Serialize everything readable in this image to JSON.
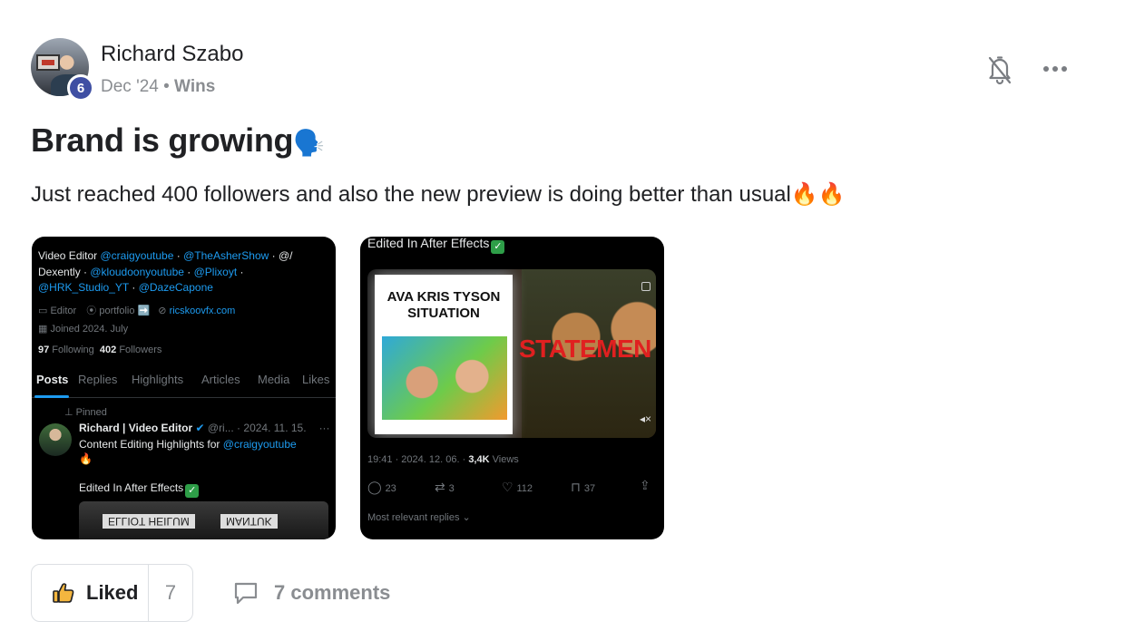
{
  "post": {
    "author": "Richard Szabo",
    "level": "6",
    "date": "Dec '24",
    "separator": " • ",
    "category": "Wins",
    "title": "Brand is growing",
    "title_emoji": "🗣️",
    "body": "Just reached 400 followers and also the new preview is doing better than usual🔥🔥"
  },
  "thumb1": {
    "line1_prefix": "Video Editor ",
    "line1_tag1": "@craigyoutube",
    "line1_dot1": " · ",
    "line1_tag2": "@TheAsherShow",
    "line1_dot2": " · @/",
    "line2_prefix": "Dexently · ",
    "line2_tag1": "@kloudoonyoutube",
    "line2_dot": " · ",
    "line2_tag2": "@Plixoyt",
    "line2_end": " ·",
    "line3_tag1": "@HRK_Studio_YT",
    "line3_dot": " · ",
    "line3_tag2": "@DazeCapone",
    "info_editor": "Editor",
    "info_portfolio": "portfolio ➡️",
    "info_link": "ricskoovfx.com",
    "joined": "Joined 2024. July",
    "following_count": "97",
    "following_label": " Following",
    "followers_count": "402",
    "followers_label": " Followers",
    "tabs": [
      "Posts",
      "Replies",
      "Highlights",
      "Articles",
      "Media",
      "Likes"
    ],
    "pinned": "Pinned",
    "post_name": "Richard | Video Editor",
    "post_handle": " @ri... · 2024. 11. 15.",
    "post_more": "···",
    "post_text": "Content Editing Highlights for ",
    "post_tag": "@craigyoutube",
    "post_emoji": "🔥",
    "post_edited": "Edited In After Effects",
    "strip_text1": "ELLIOT HEILUM",
    "strip_text2": "MANTUK"
  },
  "thumb2": {
    "top_text": "Edited In After Effects",
    "card_title": "AVA KRIS TYSON SITUATION",
    "statement": "STATEMEN",
    "meta_time": "19:41 · 2024. 12. 06. · ",
    "views_count": "3,4K",
    "views_label": " Views",
    "replies": "23",
    "reposts": "3",
    "likes": "112",
    "bookmarks": "37",
    "relevant": "Most relevant replies"
  },
  "actions": {
    "liked_label": "Liked",
    "like_count": "7",
    "comments_label": "7 comments"
  },
  "colors": {
    "badge": "#3f4fa3",
    "link_blue": "#1d9bf0",
    "muted": "#8a8d91",
    "statement_red": "#e02020"
  }
}
